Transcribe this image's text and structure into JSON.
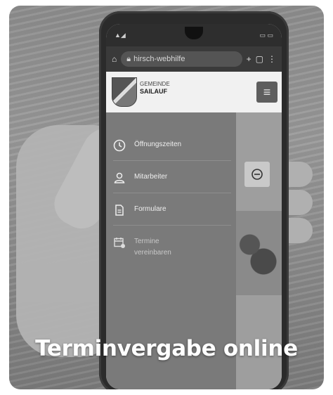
{
  "browser": {
    "url_text": "hirsch-webhilfe"
  },
  "site": {
    "name_small": "GEMEINDE",
    "name_big": "SAILAUF"
  },
  "menu": {
    "items": [
      {
        "label": "Öffnungszeiten",
        "icon": "clock-icon"
      },
      {
        "label": "Mitarbeiter",
        "icon": "person-icon"
      },
      {
        "label": "Formulare",
        "icon": "document-icon"
      },
      {
        "label": "Termine vereinbaren",
        "icon": "calendar-icon"
      }
    ]
  },
  "caption": {
    "text": "Terminvergabe online"
  },
  "colors": {
    "caption": "#ffffff",
    "menu_bg": "#7a7a7a"
  }
}
